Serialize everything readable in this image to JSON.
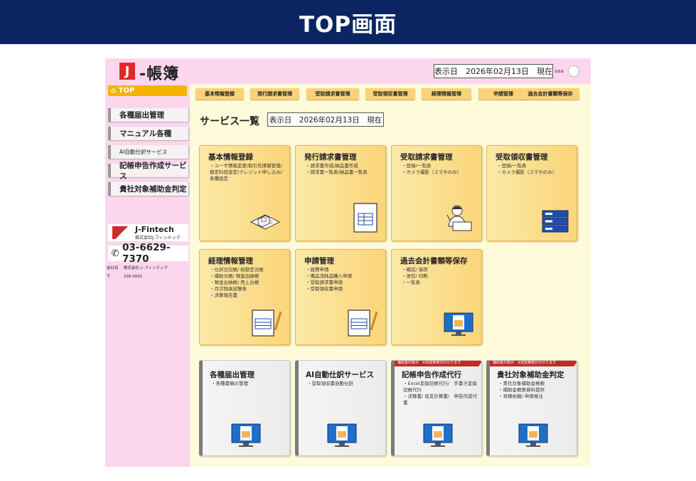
{
  "slide": {
    "title": "TOP画面"
  },
  "header": {
    "logo_mark": "J",
    "logo_text": "-帳簿",
    "date_label": "表示日　2026年02月13日　現在",
    "user_label": "aaa"
  },
  "sidebar": {
    "top_label": "⌂ TOP",
    "items": [
      {
        "label": "各種届出管理"
      },
      {
        "label": "マニュアル各種"
      },
      {
        "label": "AI自動仕訳サービス"
      },
      {
        "label": "記帳申告作成サービス"
      },
      {
        "label": "貴社対象補助金判定"
      }
    ],
    "fintech_name": "J-Fintech",
    "fintech_sub": "株式会社J-フィンテック",
    "phone": "03-6629-7370",
    "company_key": "会社名",
    "company_value": "株式会社Ｊ-フィンテック",
    "postal_key": "〒",
    "postal_value": "105-0001"
  },
  "menubar": [
    {
      "label": "基本情報登録"
    },
    {
      "label": "発行請求書管理"
    },
    {
      "label": "受取請求書管理"
    },
    {
      "label": "受取領収書管理"
    },
    {
      "label": "経理情報管理"
    },
    {
      "label": "申請管理"
    },
    {
      "label": "過去会計書類等保存"
    }
  ],
  "main": {
    "section_title": "サービス一覧",
    "section_date": "表示日　2026年02月13日　現在"
  },
  "cards": [
    {
      "title": "基本情報登録",
      "items": [
        "ユーザ情報変更/取引先情報管理/勘定科目設定/クレジット申し込み/各種設定"
      ],
      "icon": "isometric-office-icon"
    },
    {
      "title": "発行請求書管理",
      "items": [
        "請求書作成/納品書作成",
        "請求書一覧表/納品書一覧表"
      ],
      "icon": "invoice-document-icon"
    },
    {
      "title": "受取請求書管理",
      "items": [
        "登録/一覧表",
        "カメラ撮影（スマホのみ）"
      ],
      "icon": "office-worker-icon"
    },
    {
      "title": "受取領収書管理",
      "items": [
        "登録/一覧表",
        "カメラ撮影（スマホのみ）"
      ],
      "icon": "server-stack-icon"
    },
    {
      "title": "経理情報管理",
      "items": [
        "仕訳日記帳/ 総勘定元帳",
        "補助元帳/ 現金出納帳",
        "預金出納帳/ 売上台帳",
        "月次残高試算表",
        "決算報告書"
      ],
      "icon": "document-pen-icon"
    },
    {
      "title": "申請管理",
      "items": [
        "経費申請",
        "備品消耗品購入申請",
        "受取請求書申請",
        "受取領収書申請"
      ],
      "icon": "document-pen-icon"
    },
    {
      "title": "過去会計書類等保存",
      "items": [
        "確認/ 保存",
        "送信/ 印刷",
        "一覧表"
      ],
      "icon": "monitor-document-icon"
    },
    {
      "title": "各種届出管理",
      "items": [
        "各種書類の管理"
      ],
      "icon": "monitor-document-icon"
    },
    {
      "title": "AI自動仕訳サービス",
      "items": [
        "受取領収書自動仕訳"
      ],
      "icon": "monitor-document-icon"
    },
    {
      "title": "記帳申告作成代行",
      "ribbon": "補助金対象外　※別途費用がかかります",
      "items": [
        "Excel変換記帳代行/　手書き変換記帳代行",
        "決算書/ 収支計算書/　申告作成代書"
      ],
      "icon": "monitor-document-icon"
    },
    {
      "title": "貴社対象補助金判定",
      "ribbon": "補助金対象外　※別途費用がかかります",
      "items": [
        "貴社対象補助金検索",
        "補助金概要資料提供",
        "見積依頼/ 申請発注"
      ],
      "icon": "monitor-document-icon"
    }
  ],
  "colors": {
    "title_bar": "#0b2563",
    "header_pink": "#fbd6ec",
    "accent_orange": "#f5b400",
    "ribbon_red": "#c62828"
  }
}
